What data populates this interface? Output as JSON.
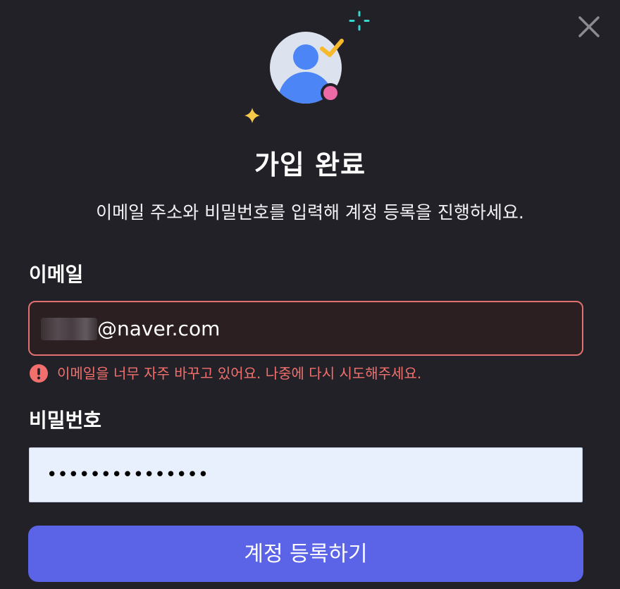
{
  "dialog": {
    "close_label": "닫기",
    "title": "가입 완료",
    "subtitle": "이메일 주소와 비밀번호를 입력해 계정 등록을 진행하세요."
  },
  "icons": {
    "close": "close-icon",
    "hero": "user-avatar-icon",
    "error": "exclamation-circle-icon"
  },
  "form": {
    "email": {
      "label": "이메일",
      "value": "@naver.com",
      "error": "이메일을 너무 자주 바꾸고 있어요. 나중에 다시 시도해주세요."
    },
    "password": {
      "label": "비밀번호",
      "masked_value": "•••••••••••••••"
    },
    "submit_label": "계정 등록하기"
  },
  "colors": {
    "background": "#222127",
    "error": "#f1706e",
    "primary_button": "#5b63e6",
    "avatar_blue": "#4c86f6",
    "check_yellow": "#f5b92b",
    "dot_pink": "#ed6aa6",
    "sparkle_teal": "#38d6cf",
    "sparkle_yellow": "#f7c948"
  }
}
